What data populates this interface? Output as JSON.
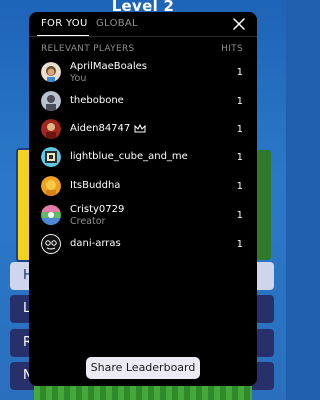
{
  "background": {
    "title": "Level 2",
    "menu_items": [
      "H",
      "L",
      "R",
      "N"
    ]
  },
  "leaderboard": {
    "tabs": [
      {
        "label": "FOR YOU",
        "active": true
      },
      {
        "label": "GLOBAL",
        "active": false
      }
    ],
    "close_icon": "close-icon",
    "header": {
      "players_label": "RELEVANT PLAYERS",
      "hits_label": "HITS"
    },
    "players": [
      {
        "name": "AprilMaeBoales",
        "subtitle": "You",
        "hits": "1"
      },
      {
        "name": "thebobone",
        "subtitle": "",
        "hits": "1"
      },
      {
        "name": "Aiden84747",
        "subtitle": "",
        "hits": "1",
        "badge_icon": "crown-icon"
      },
      {
        "name": "lightblue_cube_and_me",
        "subtitle": "",
        "hits": "1"
      },
      {
        "name": "ItsBuddha",
        "subtitle": "",
        "hits": "1"
      },
      {
        "name": "Cristy0729",
        "subtitle": "Creator",
        "hits": "1"
      },
      {
        "name": "dani-arras",
        "subtitle": "",
        "hits": "1"
      }
    ],
    "share_label": "Share Leaderboard"
  },
  "colors": {
    "panel_bg": "#000000",
    "background_blue": "#1f5fae",
    "share_button_bg": "#eceaf3"
  }
}
